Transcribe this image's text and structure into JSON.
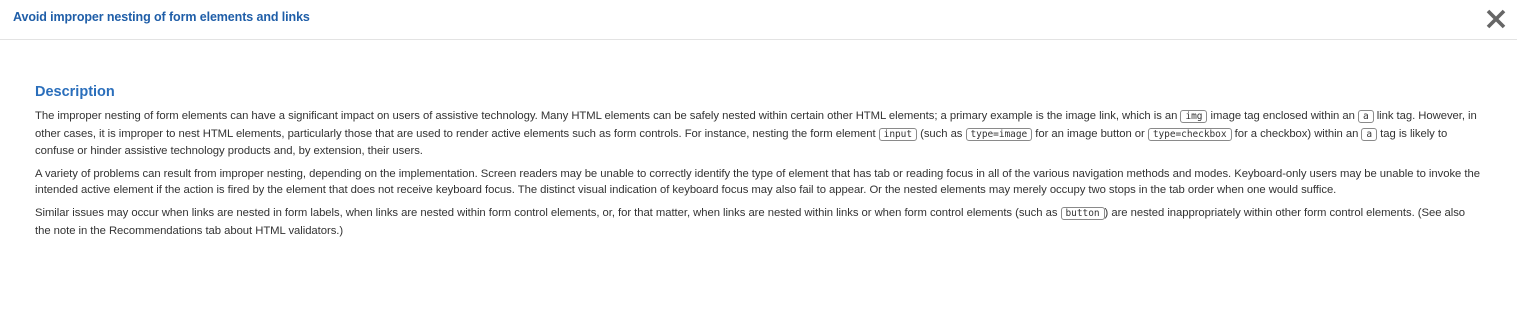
{
  "dialog": {
    "title": "Avoid improper nesting of form elements and links",
    "close_icon": "close-icon"
  },
  "description": {
    "heading": "Description",
    "p1": {
      "t1": "The improper nesting of form elements can have a significant impact on users of assistive technology. Many HTML elements can be safely nested within certain other HTML elements; a primary example is the image link, which is an ",
      "c1": "img",
      "t2": " image tag enclosed within an ",
      "c2": "a",
      "t3": " link tag. However, in other cases, it is improper to nest HTML elements, particularly those that are used to render active elements such as form controls. For instance, nesting the form element ",
      "c3": "input",
      "t4": " (such as ",
      "c4": "type=image",
      "t5": " for an image button or ",
      "c5": "type=checkbox",
      "t6": " for a checkbox) within an ",
      "c6": "a",
      "t7": " tag is likely to confuse or hinder assistive technology products and, by extension, their users."
    },
    "p2": "A variety of problems can result from improper nesting, depending on the implementation. Screen readers may be unable to correctly identify the type of element that has tab or reading focus in all of the various navigation methods and modes. Keyboard-only users may be unable to invoke the intended active element if the action is fired by the element that does not receive keyboard focus. The distinct visual indication of keyboard focus may also fail to appear. Or the nested elements may merely occupy two stops in the tab order when one would suffice.",
    "p3": {
      "t1": "Similar issues may occur when links are nested in form labels, when links are nested within form control elements, or, for that matter, when links are nested within links or when form control elements (such as ",
      "c1": "button",
      "t2": ") are nested inappropriately within other form control elements. (See also the note in the Recommendations tab about HTML validators.)"
    }
  },
  "colors": {
    "title": "#1f5ea8",
    "heading": "#2a6ebb",
    "body_text": "#333333",
    "close_icon": "#666666"
  }
}
